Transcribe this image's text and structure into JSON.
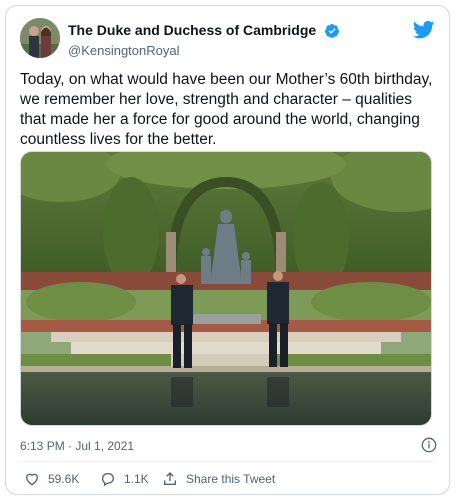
{
  "author": {
    "display_name": "The Duke and Duchess of Cambridge",
    "handle": "@KensingtonRoyal"
  },
  "tweet": {
    "text": "Today, on what would have been our Mother’s 60th birthday, we remember her love, strength and character – qualities that made her a force for good around the world, changing countless lives for the better.",
    "timestamp": "6:13 PM · Jul 1, 2021"
  },
  "actions": {
    "likes": "59.6K",
    "replies": "1.1K",
    "share_label": "Share this Tweet"
  },
  "icons": {
    "verified": "verified-badge-icon",
    "brand": "twitter-bird-icon",
    "info": "info-icon",
    "like": "heart-icon",
    "reply": "reply-bubble-icon",
    "share": "share-icon"
  },
  "colors": {
    "brand_blue": "#1d9bf0",
    "secondary_text": "#536471",
    "border": "#cfd9de"
  }
}
